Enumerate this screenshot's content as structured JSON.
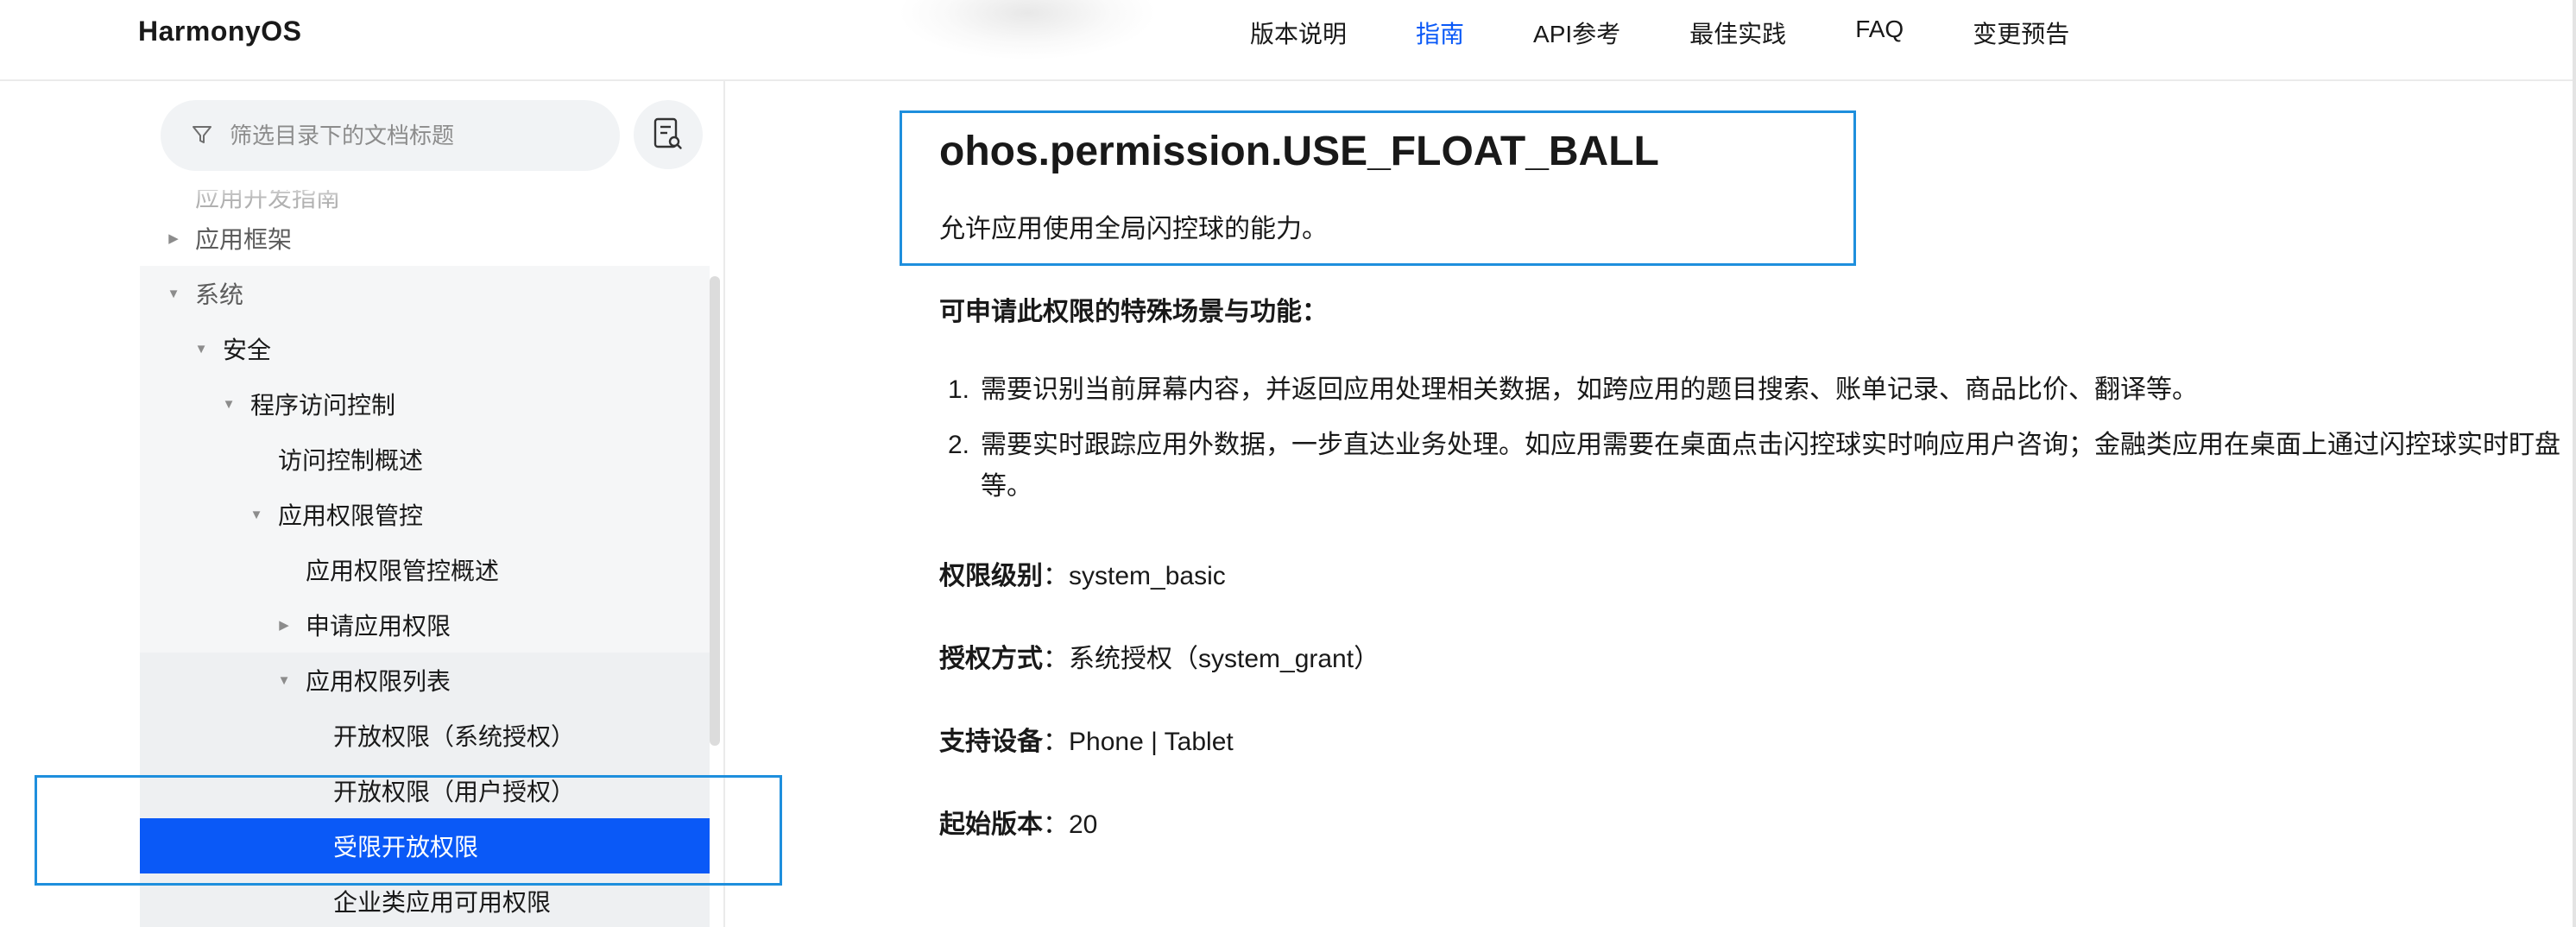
{
  "header": {
    "logo": "HarmonyOS",
    "nav": [
      {
        "label": "版本说明",
        "active": false
      },
      {
        "label": "指南",
        "active": true
      },
      {
        "label": "API参考",
        "active": false
      },
      {
        "label": "最佳实践",
        "active": false
      },
      {
        "label": "FAQ",
        "active": false
      },
      {
        "label": "变更预告",
        "active": false
      }
    ],
    "accent_color": "#0a59f7"
  },
  "sidebar": {
    "filter_placeholder": "筛选目录下的文档标题",
    "filter_icon": "filter-icon",
    "doc_button_icon": "document-search-icon",
    "tree": [
      {
        "label": "应用开发指南",
        "caret": "none",
        "state": "faded"
      },
      {
        "label": "应用框架",
        "caret": "collapsed",
        "state": "dim"
      },
      {
        "label": "系统",
        "caret": "expanded",
        "state": "dim"
      },
      {
        "label": "安全",
        "caret": "expanded",
        "state": "normal"
      },
      {
        "label": "程序访问控制",
        "caret": "expanded",
        "state": "normal"
      },
      {
        "label": "访问控制概述",
        "caret": "none",
        "state": "normal"
      },
      {
        "label": "应用权限管控",
        "caret": "expanded",
        "state": "normal"
      },
      {
        "label": "应用权限管控概述",
        "caret": "none",
        "state": "normal"
      },
      {
        "label": "申请应用权限",
        "caret": "collapsed",
        "state": "normal"
      },
      {
        "label": "应用权限列表",
        "caret": "expanded",
        "state": "normal"
      },
      {
        "label": "开放权限（系统授权）",
        "caret": "none",
        "state": "normal"
      },
      {
        "label": "开放权限（用户授权）",
        "caret": "none",
        "state": "normal"
      },
      {
        "label": "受限开放权限",
        "caret": "none",
        "state": "selected"
      },
      {
        "label": "企业类应用可用权限",
        "caret": "none",
        "state": "normal"
      }
    ]
  },
  "content": {
    "title": "ohos.permission.USE_FLOAT_BALL",
    "description": "允许应用使用全局闪控球的能力。",
    "scenario_heading": "可申请此权限的特殊场景与功能：",
    "scenarios": [
      {
        "num": "1.",
        "text": "需要识别当前屏幕内容，并返回应用处理相关数据，如跨应用的题目搜索、账单记录、商品比价、翻译等。"
      },
      {
        "num": "2.",
        "text": "需要实时跟踪应用外数据，一步直达业务处理。如应用需要在桌面点击闪控球实时响应用户咨询；金融类应用在桌面上通过闪控球实时盯盘等。"
      }
    ],
    "props": [
      {
        "key": "权限级别",
        "value": "system_basic"
      },
      {
        "key": "授权方式",
        "value": "系统授权（system_grant）"
      },
      {
        "key": "支持设备",
        "value": "Phone | Tablet"
      },
      {
        "key": "起始版本",
        "value": "20"
      }
    ]
  }
}
